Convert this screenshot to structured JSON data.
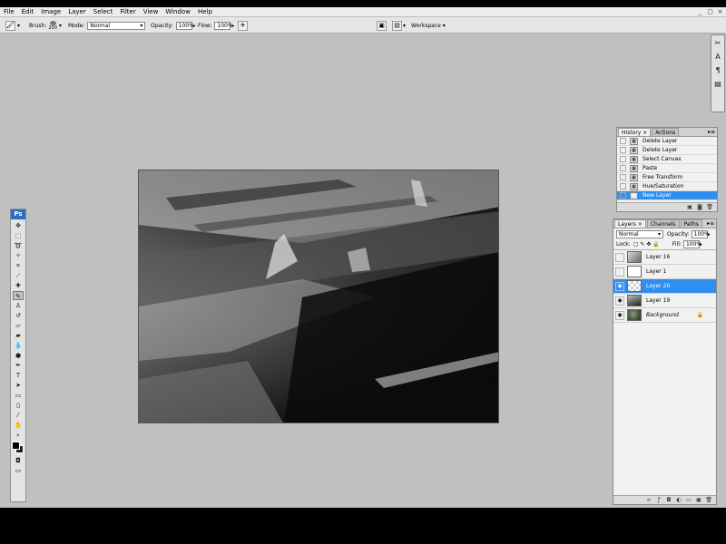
{
  "menubar": {
    "items": [
      "File",
      "Edit",
      "Image",
      "Layer",
      "Select",
      "Filter",
      "View",
      "Window",
      "Help"
    ],
    "window_controls": [
      "_",
      "▢",
      "×"
    ]
  },
  "options": {
    "brush_label": "Brush:",
    "brush_size": "200",
    "mode_label": "Mode:",
    "mode_value": "Normal",
    "opacity_label": "Opacity:",
    "opacity_value": "100%",
    "flow_label": "Flow:",
    "flow_value": "100%",
    "workspace_label": "Workspace ▾"
  },
  "history": {
    "tabs": [
      "History ×",
      "Actions"
    ],
    "items": [
      "Delete Layer",
      "Delete Layer",
      "Select Canvas",
      "Paste",
      "Free Transform",
      "Hue/Saturation",
      "New Layer"
    ],
    "selected_index": 6
  },
  "layers": {
    "tabs": [
      "Layers ×",
      "Channels",
      "Paths"
    ],
    "blend_mode": "Normal",
    "opacity_label": "Opacity:",
    "opacity_value": "100%",
    "lock_label": "Lock:",
    "fill_label": "Fill:",
    "fill_value": "100%",
    "items": [
      {
        "name": "Layer 16",
        "visible": false
      },
      {
        "name": "Layer 1",
        "visible": false
      },
      {
        "name": "Layer 20",
        "visible": true,
        "selected": true
      },
      {
        "name": "Layer 19",
        "visible": true
      },
      {
        "name": "Background",
        "visible": true,
        "locked": true
      }
    ]
  },
  "toolbox": {
    "logo": "Ps"
  },
  "colors": {
    "selection": "#2f8ff0",
    "workspace": "#c0c0c0",
    "ps_logo": "#2b6fc4"
  }
}
